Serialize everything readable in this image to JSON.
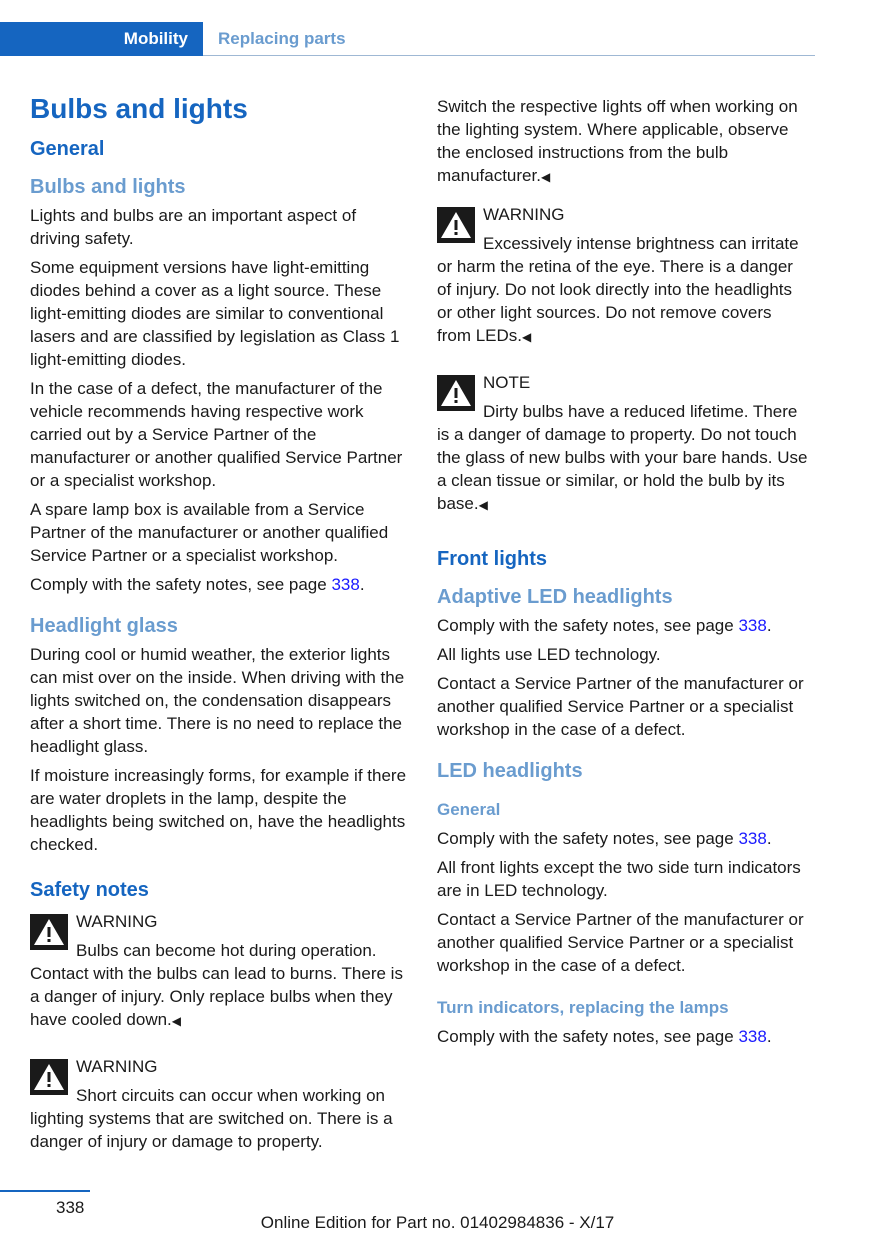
{
  "header": {
    "section": "Mobility",
    "subsection": "Replacing parts"
  },
  "left": {
    "title": "Bulbs and lights",
    "general": "General",
    "bulbs_heading": "Bulbs and lights",
    "p1": "Lights and bulbs are an important aspect of driving safety.",
    "p2": "Some equipment versions have light-emitting diodes behind a cover as a light source. These light-emitting diodes are similar to conventional lasers and are classified by legislation as Class 1 light-emitting diodes.",
    "p3": "In the case of a defect, the manufacturer of the vehicle recommends having respective work carried out by a Service Partner of the manufacturer or another qualified Service Partner or a specialist workshop.",
    "p4": "A spare lamp box is available from a Service Partner of the manufacturer or another qualified Service Partner or a specialist workshop.",
    "p5": "Comply with the safety notes, see page",
    "p5_page": "338",
    "headlight_heading": "Headlight glass",
    "p6": "During cool or humid weather, the exterior lights can mist over on the inside. When driving with the lights switched on, the condensation disappears after a short time. There is no need to replace the headlight glass.",
    "p7": "If moisture increasingly forms, for example if there are water droplets in the lamp, despite the headlights being switched on, have the headlights checked.",
    "safety_heading": "Safety notes",
    "warn1_label": "WARNING",
    "warn1_text": "Bulbs can become hot during operation. Contact with the bulbs can lead to burns. There is a danger of injury. Only replace bulbs when they have cooled down.",
    "warn2_label": "WARNING",
    "warn2_text": "Short circuits can occur when working on lighting systems that are switched on. There is a danger of injury or damage to property."
  },
  "right": {
    "p1": "Switch the respective lights off when working on the lighting system. Where applicable, observe the enclosed instructions from the bulb manufacturer.",
    "warn_label": "WARNING",
    "warn_text": "Excessively intense brightness can irritate or harm the retina of the eye. There is a danger of injury. Do not look directly into the headlights or other light sources. Do not remove covers from LEDs.",
    "note_label": "NOTE",
    "note_text": "Dirty bulbs have a reduced lifetime. There is a danger of damage to property. Do not touch the glass of new bulbs with your bare hands. Use a clean tissue or similar, or hold the bulb by its base.",
    "front_heading": "Front lights",
    "adaptive_heading": "Adaptive LED headlights",
    "comply": "Comply with the safety notes, see page",
    "page_ref": "338",
    "p_all_led": "All lights use LED technology.",
    "p_contact": "Contact a Service Partner of the manufacturer or another qualified Service Partner or a specialist workshop in the case of a defect.",
    "led_heading": "LED headlights",
    "general_sub": "General",
    "p_front_except": "All front lights except the two side turn indicators are in LED technology.",
    "turn_heading": "Turn indicators, replacing the lamps"
  },
  "footer": {
    "page_number": "338",
    "edition": "Online Edition for Part no. 01402984836 - X/17"
  }
}
